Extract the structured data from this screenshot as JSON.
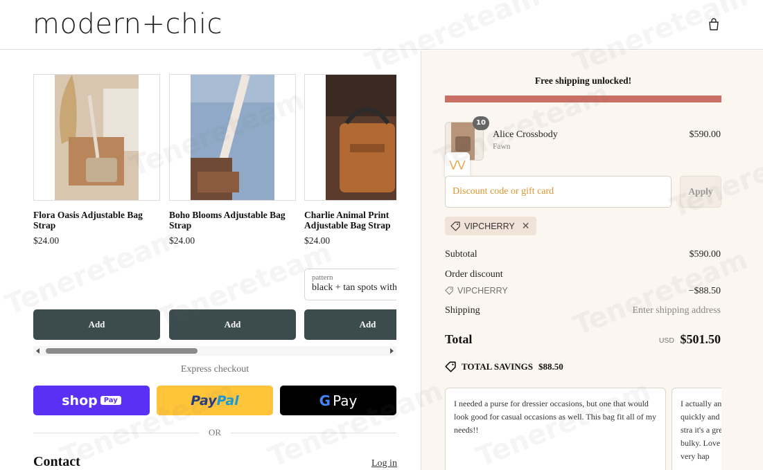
{
  "header": {
    "logo": "modern+chic",
    "cart_icon": "shopping-bag-icon"
  },
  "recommendations": [
    {
      "title": "Flora Oasis Adjustable Bag Strap",
      "price": "$24.00",
      "add_label": "Add"
    },
    {
      "title": "Boho Blooms Adjustable Bag Strap",
      "price": "$24.00",
      "add_label": "Add"
    },
    {
      "title": "Charlie Animal Print Adjustable Bag Strap",
      "price": "$24.00",
      "add_label": "Add",
      "variant": {
        "label": "pattern",
        "value": "black + tan spots with"
      }
    }
  ],
  "express": {
    "label": "Express checkout",
    "shop_pay": {
      "word": "shop",
      "badge": "Pay"
    },
    "paypal": {
      "part1": "Pay",
      "part2": "Pal"
    },
    "gpay": {
      "g": "G",
      "word": "Pay"
    },
    "or": "OR"
  },
  "contact": {
    "heading": "Contact",
    "login": "Log in"
  },
  "summary": {
    "shipping_message": "Free shipping unlocked!",
    "shipping_progress": 1.0,
    "item": {
      "name": "Alice Crossbody",
      "variant": "Fawn",
      "price": "$590.00",
      "quantity": "10"
    },
    "discount": {
      "placeholder": "Discount code or gift card",
      "apply": "Apply",
      "applied_code": "VIPCHERRY"
    },
    "subtotal_label": "Subtotal",
    "subtotal_value": "$590.00",
    "order_discount_label": "Order discount",
    "order_discount_code": "VIPCHERRY",
    "order_discount_value": "−$88.50",
    "shipping_label": "Shipping",
    "shipping_value": "Enter shipping address",
    "total_label": "Total",
    "total_currency": "USD",
    "total_value": "$501.50",
    "savings_label": "TOTAL SAVINGS",
    "savings_value": "$88.50",
    "reviews": [
      "I needed a purse for dressier occasions, but one that would look good for casual occasions as well. This bag fit all of my needs!!",
      "I actually and quickly and out the stra it's a great s bulky. Love am very hap"
    ]
  },
  "colors": {
    "accent_bar": "#c96f63",
    "add_button": "#3c4b4d",
    "shop_pay": "#5a31f4",
    "paypal": "#ffc439",
    "summary_bg": "#fbf6f0"
  },
  "watermark": "Tenereteam"
}
